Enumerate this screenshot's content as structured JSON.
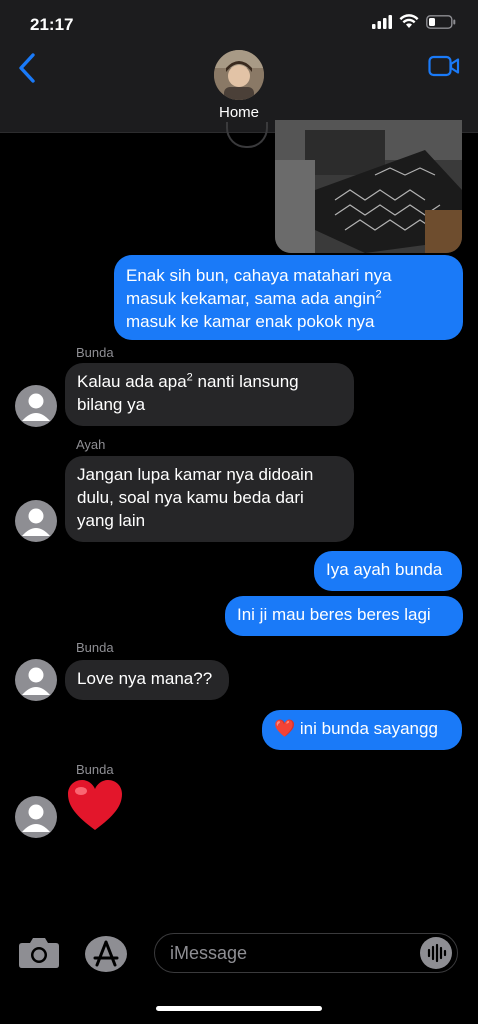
{
  "status": {
    "time": "21:17"
  },
  "header": {
    "contact": "Home"
  },
  "messages": [
    {
      "line1": "Enak sih bun, cahaya matahari nya",
      "line2a": "masuk kekamar, sama ada angin",
      "line2sup": "2",
      "line3": "masuk ke kamar enak pokok nya"
    },
    {
      "sender": "Bunda",
      "line1a": "Kalau ada apa",
      "line1sup": "2",
      "line1b": " nanti lansung",
      "line2": "bilang ya"
    },
    {
      "sender": "Ayah",
      "line1": "Jangan lupa kamar nya didoain",
      "line2": "dulu, soal nya kamu beda dari",
      "line3": "yang lain"
    },
    {
      "text": "Iya ayah bunda"
    },
    {
      "text": "Ini ji mau beres beres lagi"
    },
    {
      "sender": "Bunda",
      "text": "Love nya mana??"
    },
    {
      "text": "ini bunda sayangg",
      "emoji": "❤️"
    },
    {
      "sender": "Bunda",
      "emoji": "❤️"
    }
  ],
  "composer": {
    "placeholder": "iMessage"
  },
  "colors": {
    "outgoing": "#1a7af8",
    "incoming": "#262628",
    "accent": "#1a7af8"
  }
}
